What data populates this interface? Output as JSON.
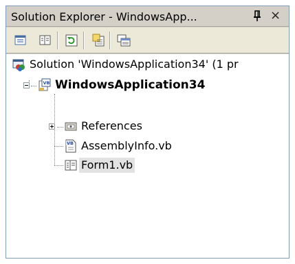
{
  "window": {
    "title": "Solution Explorer - WindowsApp...",
    "pin_icon": "pin-icon",
    "close_glyph": "×"
  },
  "toolbar": {
    "buttons": [
      {
        "name": "properties-button",
        "icon": "properties-icon"
      },
      {
        "name": "show-all-files-button",
        "icon": "show-all-files-icon"
      },
      {
        "name": "refresh-button",
        "icon": "refresh-icon"
      },
      {
        "name": "view-code-button",
        "icon": "view-code-icon"
      },
      {
        "name": "view-designer-button",
        "icon": "view-designer-icon"
      }
    ]
  },
  "tree": {
    "solution": {
      "label": "Solution 'WindowsApplication34' (1 pr",
      "icon": "solution-icon"
    },
    "project": {
      "label": "WindowsApplication34",
      "icon": "vb-project-icon",
      "expanded": true
    },
    "items": [
      {
        "label": "References",
        "icon": "references-icon",
        "expandable": true
      },
      {
        "label": "AssemblyInfo.vb",
        "icon": "vb-file-icon",
        "expandable": false
      },
      {
        "label": "Form1.vb",
        "icon": "form-icon",
        "expandable": false,
        "selected": true
      }
    ]
  },
  "colors": {
    "titlebar": "#d4d0c8",
    "toolbar": "#ece9d8",
    "border": "#7f9db9",
    "selection": "#e2e2e2"
  }
}
